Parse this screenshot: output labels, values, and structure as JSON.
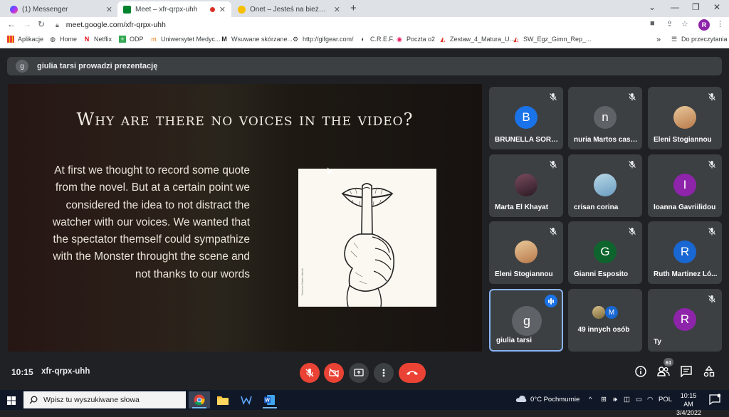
{
  "browser": {
    "tabs": [
      {
        "title": "(1) Messenger",
        "close": "✕"
      },
      {
        "title": "Meet – xfr-qrpx-uhh",
        "close": "✕"
      },
      {
        "title": "Onet – Jesteś na bieżąco",
        "close": "✕"
      }
    ],
    "new_tab": "+",
    "window_controls": {
      "minimize": "—",
      "maximize": "❐",
      "close": "✕",
      "tab_search": "⌄"
    },
    "url": "meet.google.com/xfr-qrpx-uhh",
    "profile_initial": "R",
    "bookmarks": [
      "Aplikacje",
      "Home",
      "Netflix",
      "ODP",
      "Uniwersytet Medyc...",
      "Wsuwane skórzane...",
      "http://gifgear.com/",
      "C.R.E.F.",
      "Poczta o2",
      "Zestaw_4_Matura_U...",
      "SW_Egz_Gimn_Rep_...",
      "Do przeczytania"
    ],
    "bookmarks_overflow": "»"
  },
  "meet": {
    "presenter_initial": "g",
    "presenter_banner": "giulia tarsi prowadzi prezentację",
    "slide": {
      "title": "Why are there no voices in the video?",
      "body": "At first we thought to record some quote from the novel. But at a certain point we considered the idea to not distract the watcher with our voices. We wanted that the spectator themself could sympathize with the Monster throught the scene and not thanks to our words",
      "image_caption": "Fabbrica Studio Lotterati"
    },
    "participants": [
      {
        "name": "BRUNELLA SORBE...",
        "initial": "B",
        "color": "#1a73e8",
        "muted": true
      },
      {
        "name": "nuria Martos casa...",
        "initial": "n",
        "color": "#5f6368",
        "muted": true
      },
      {
        "name": "Eleni Stogiannou",
        "initial": "",
        "color": "#c9a27a",
        "muted": true
      },
      {
        "name": "Marta El Khayat",
        "initial": "",
        "color": "#5a3a4a",
        "muted": true
      },
      {
        "name": "crisan corina",
        "initial": "",
        "color": "#8fb7c9",
        "muted": true
      },
      {
        "name": "Ioanna Gavriilidou",
        "initial": "I",
        "color": "#8e24aa",
        "muted": true
      },
      {
        "name": "Eleni Stogiannou",
        "initial": "",
        "color": "#c9a27a",
        "muted": true
      },
      {
        "name": "Gianni Esposito",
        "initial": "G",
        "color": "#0d652d",
        "muted": true
      },
      {
        "name": "Ruth Martinez Ló...",
        "initial": "R",
        "color": "#1967d2",
        "muted": true
      },
      {
        "name": "giulia tarsi",
        "initial": "g",
        "color": "#5f6368",
        "muted": false
      },
      {
        "name": "49 innych osób",
        "initial": "M",
        "color": "#1967d2",
        "muted": false
      },
      {
        "name": "Ty",
        "initial": "R",
        "color": "#8e24aa",
        "muted": true
      }
    ],
    "time": "10:15",
    "meeting_code": "xfr-qrpx-uhh",
    "people_count": "61"
  },
  "taskbar": {
    "search_placeholder": "Wpisz tu wyszukiwane słowa",
    "weather": "0°C  Pochmurnie",
    "language": "POL",
    "time": "10:15 AM",
    "date": "3/4/2022"
  }
}
